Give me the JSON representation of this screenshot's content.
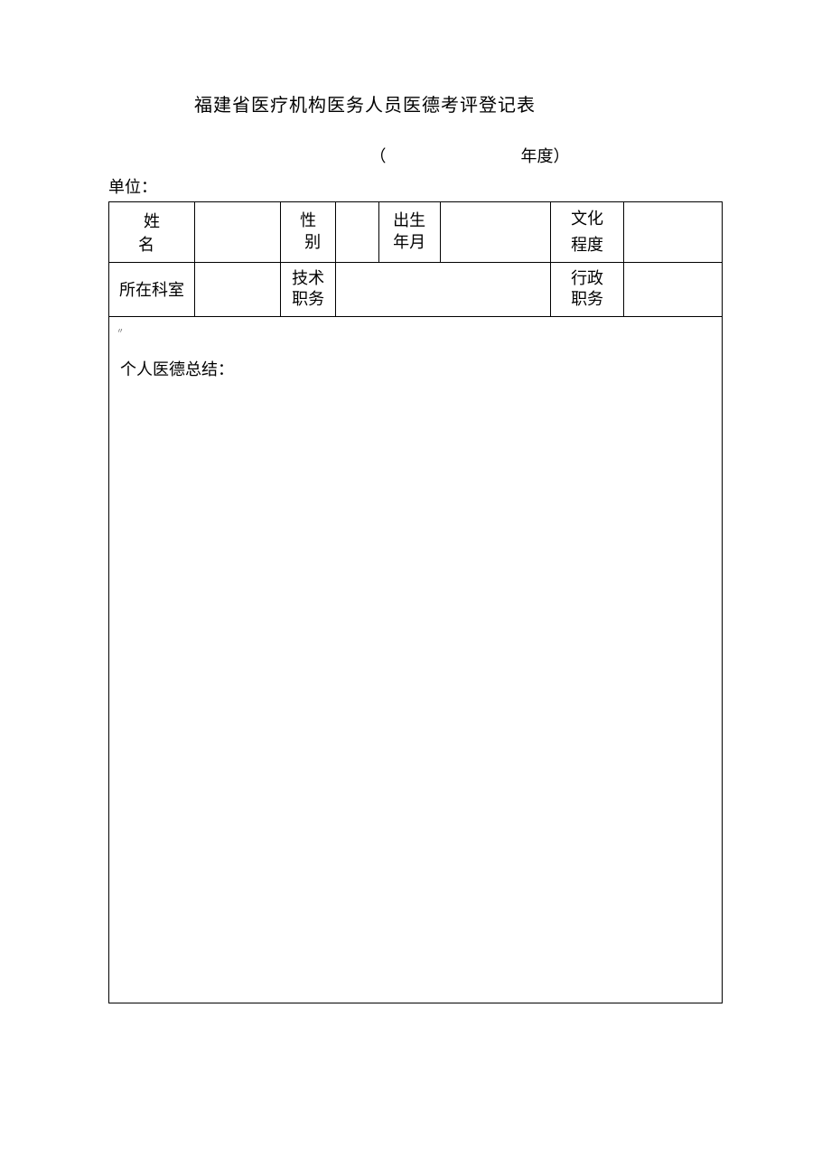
{
  "title": "福建省医疗机构医务人员医德考评登记表",
  "year_paren_open": "（",
  "year_paren_close": "年度）",
  "unit_label": "单位：",
  "row1": {
    "name_label": "姓　名",
    "name_value": "",
    "gender_label_line1": "性",
    "gender_label_line2": "别",
    "gender_value": "",
    "birth_label_line1": "出生",
    "birth_label_line2": "年月",
    "birth_value": "",
    "edu_label_line1": "文化",
    "edu_label_line2": "程度",
    "edu_value": ""
  },
  "row2": {
    "dept_label": "所在科室",
    "dept_value": "",
    "tech_label_line1": "技术",
    "tech_label_line2": "职务",
    "tech_value": "",
    "admin_label_line1": "行政",
    "admin_label_line2": "职务",
    "admin_value": ""
  },
  "summary_label": "个人医德总结：",
  "summary_mark": "〃"
}
